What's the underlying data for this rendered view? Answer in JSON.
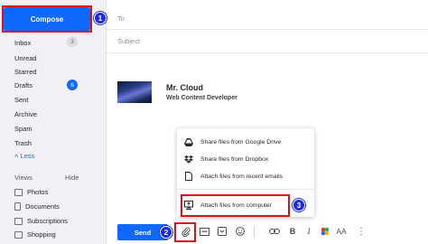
{
  "sidebar": {
    "compose_label": "Compose",
    "items": [
      {
        "label": "Inbox",
        "count": "3"
      },
      {
        "label": "Unread",
        "count": ""
      },
      {
        "label": "Starred",
        "count": ""
      },
      {
        "label": "Drafts",
        "count": "6"
      },
      {
        "label": "Sent",
        "count": ""
      },
      {
        "label": "Archive",
        "count": ""
      },
      {
        "label": "Spam",
        "count": ""
      },
      {
        "label": "Trash",
        "count": ""
      }
    ],
    "less_label": "˄ Less",
    "views_label": "Views",
    "hide_label": "Hide",
    "views": [
      {
        "label": "Photos",
        "icon": "photo-icon"
      },
      {
        "label": "Documents",
        "icon": "document-icon"
      },
      {
        "label": "Subscriptions",
        "icon": "subscriptions-icon"
      },
      {
        "label": "Shopping",
        "icon": "shopping-icon"
      }
    ]
  },
  "compose": {
    "to_label": "To",
    "subject_placeholder": "Subject",
    "signature": {
      "name": "Mr. Cloud",
      "role": "Web Content Developer"
    }
  },
  "attach_menu": {
    "items": [
      {
        "label": "Share files from Google Drive",
        "icon": "google-drive-icon"
      },
      {
        "label": "Share files from Dropbox",
        "icon": "dropbox-icon"
      },
      {
        "label": "Attach files from recent emails",
        "icon": "file-icon"
      },
      {
        "label": "Attach files from computer",
        "icon": "computer-icon"
      }
    ]
  },
  "toolbar": {
    "send_label": "Send",
    "font_label": "AA"
  },
  "steps": [
    "1",
    "2",
    "3"
  ],
  "colors": {
    "accent": "#0f69ff",
    "highlight": "#d8121b",
    "step_badge": "#1d2be0"
  }
}
